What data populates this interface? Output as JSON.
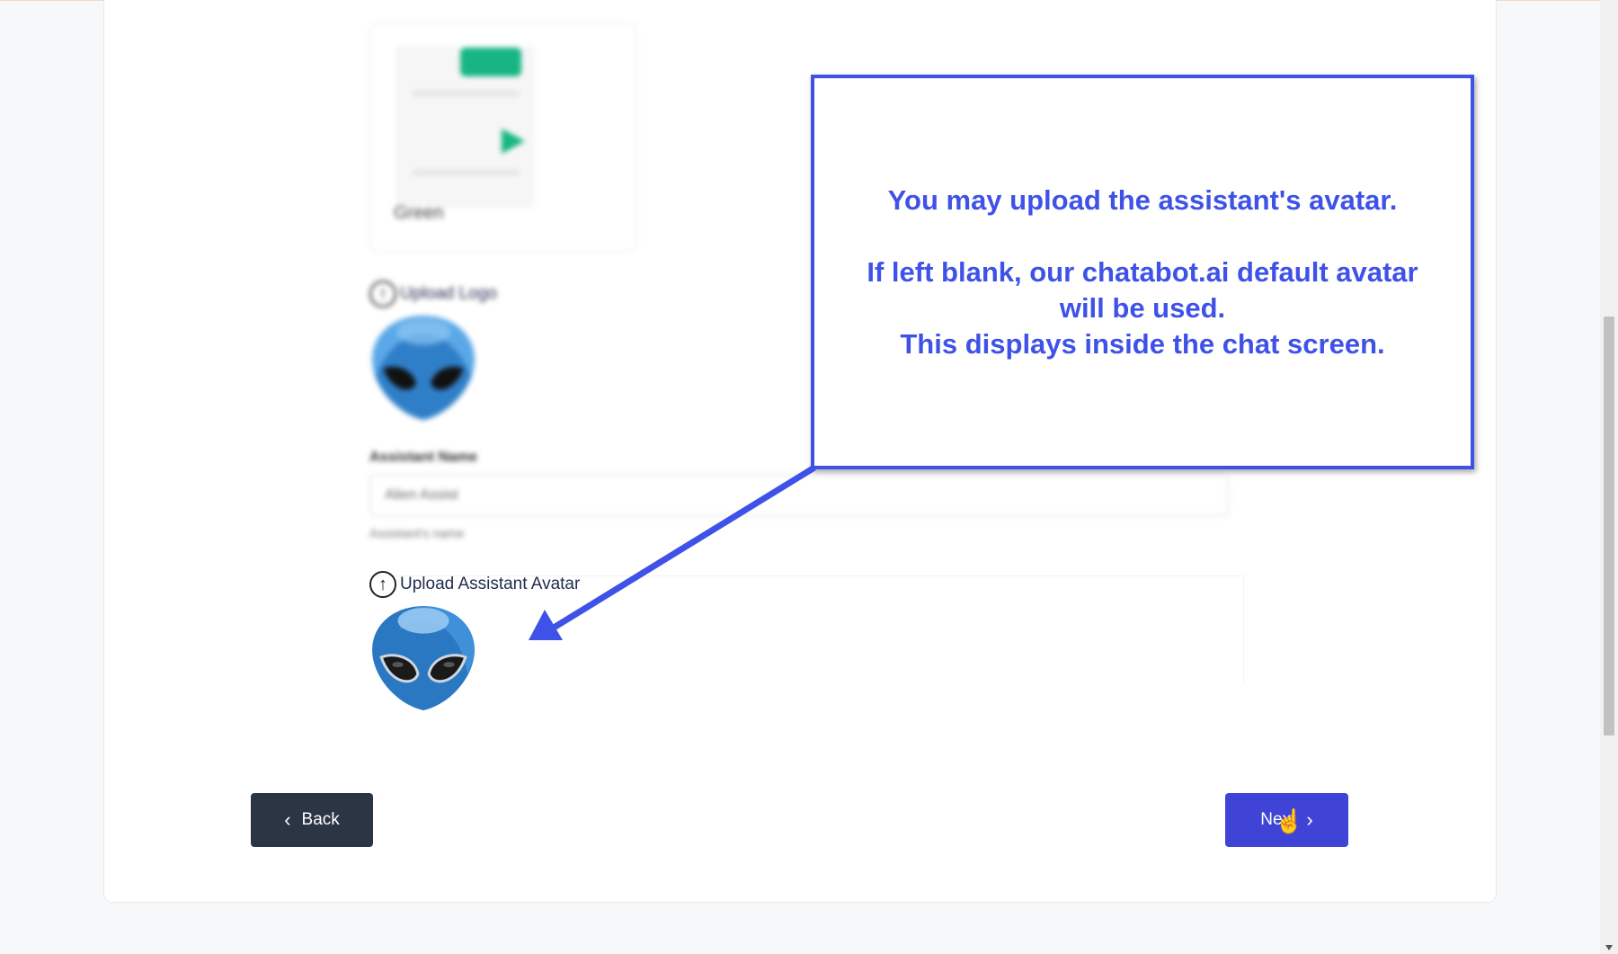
{
  "theme": {
    "name": "Green",
    "accent": "#18b583"
  },
  "logo_upload": {
    "label": "Upload Logo"
  },
  "assistant_name": {
    "label": "Assistant Name",
    "value": "Alien Assist",
    "help": "Assistant's name"
  },
  "avatar_upload": {
    "label": "Upload Assistant Avatar"
  },
  "callout": {
    "line1": "You may upload the assistant's avatar.",
    "line2": "If left blank, our chatabot.ai default avatar",
    "line3": "will be used.",
    "line4": "This displays inside the chat screen.",
    "color": "#3f52e8"
  },
  "nav": {
    "back_label": "Back",
    "next_label": "Next",
    "next_color": "#3f44d6",
    "back_color": "#2c3544"
  },
  "icons": {
    "upload": "upload-circle-icon",
    "back": "chevron-left-icon",
    "next": "chevron-right-icon",
    "cursor": "hand-pointer-icon"
  }
}
